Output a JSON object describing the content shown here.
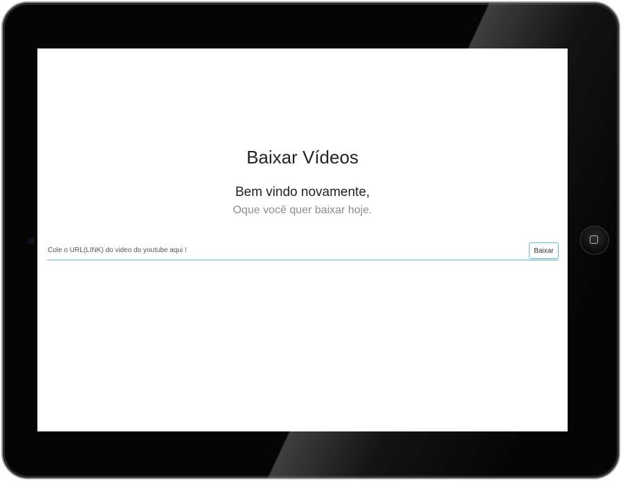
{
  "app": {
    "title": "Baixar Vídeos",
    "welcome": "Bem vindo novamente,",
    "subtitle": "Oque você quer baixar hoje."
  },
  "search": {
    "value": "",
    "placeholder": "Cole o URL(LINK) do video do youtube aqui !",
    "button_label": "Baixar"
  },
  "device": {
    "icons": [
      "camera-icon",
      "home-button-icon"
    ]
  },
  "colors": {
    "accent": "#5bb8d4",
    "bezel": "#050505",
    "title_text": "#222222",
    "subtitle_text": "#8d8d8d"
  }
}
